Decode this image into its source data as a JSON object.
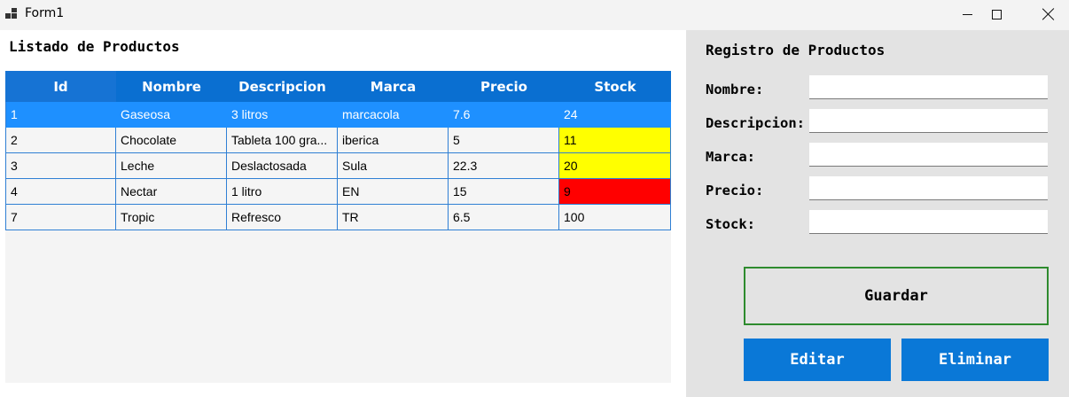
{
  "window": {
    "title": "Form1"
  },
  "list": {
    "title": "Listado de Productos",
    "columns": [
      "Id",
      "Nombre",
      "Descripcion",
      "Marca",
      "Precio",
      "Stock"
    ],
    "rows": [
      {
        "id": "1",
        "nombre": "Gaseosa",
        "descripcion": "3 litros",
        "marca": "marcacola",
        "precio": "7.6",
        "stock": "24",
        "selected": true
      },
      {
        "id": "2",
        "nombre": "Chocolate",
        "descripcion": "Tableta 100 gra...",
        "marca": "iberica",
        "precio": "5",
        "stock": "11",
        "stock_color": "#ffff00"
      },
      {
        "id": "3",
        "nombre": "Leche",
        "descripcion": "Deslactosada",
        "marca": "Sula",
        "precio": "22.3",
        "stock": "20",
        "stock_color": "#ffff00"
      },
      {
        "id": "4",
        "nombre": "Nectar",
        "descripcion": "1 litro",
        "marca": "EN",
        "precio": "15",
        "stock": "9",
        "stock_color": "#ff0000"
      },
      {
        "id": "7",
        "nombre": "Tropic",
        "descripcion": "Refresco",
        "marca": "TR",
        "precio": "6.5",
        "stock": "100"
      }
    ]
  },
  "form": {
    "title": "Registro de Productos",
    "labels": {
      "nombre": "Nombre:",
      "descripcion": "Descripcion:",
      "marca": "Marca:",
      "precio": "Precio:",
      "stock": "Stock:"
    },
    "values": {
      "nombre": "",
      "descripcion": "",
      "marca": "",
      "precio": "",
      "stock": ""
    },
    "buttons": {
      "guardar": "Guardar",
      "editar": "Editar",
      "eliminar": "Eliminar"
    }
  },
  "colors": {
    "header_blue": "#0a6fd1",
    "selected_row": "#1e90ff",
    "button_blue": "#0a78d7",
    "guardar_border": "#2e8b2e",
    "warn_yellow": "#ffff00",
    "low_red": "#ff0000"
  },
  "icons": {
    "app": "windows-form-icon",
    "minimize": "minimize-icon",
    "maximize": "maximize-icon",
    "close": "close-icon"
  }
}
